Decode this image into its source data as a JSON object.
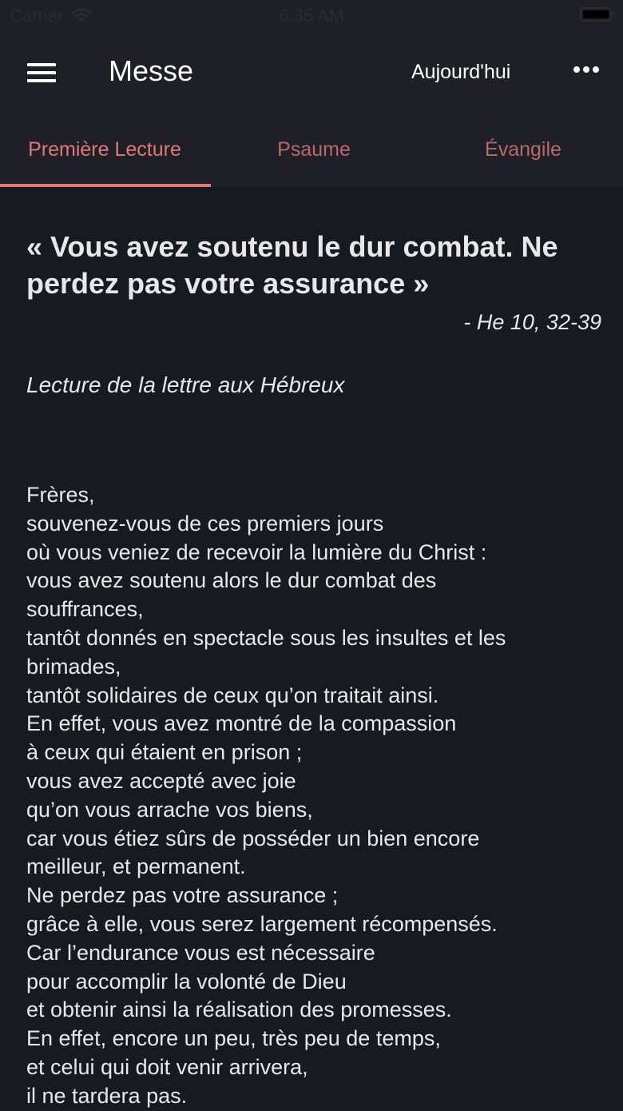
{
  "status": {
    "carrier": "Carrier",
    "time": "6:35 AM"
  },
  "navbar": {
    "title": "Messe",
    "today_label": "Aujourd'hui"
  },
  "tabs": [
    {
      "label": "Première Lecture",
      "active": true
    },
    {
      "label": "Psaume",
      "active": false
    },
    {
      "label": "Évangile",
      "active": false
    }
  ],
  "reading": {
    "title": "« Vous avez soutenu le dur combat. Ne perdez pas votre assurance »",
    "reference": "- He 10, 32-39",
    "intro": "Lecture de la lettre aux Hébreux",
    "lines": [
      "Frères,",
      "souvenez-vous de ces premiers jours",
      "où vous veniez de recevoir la lumière du Christ :",
      "vous avez soutenu alors le dur combat des",
      "souffrances,",
      "tantôt donnés en spectacle sous les insultes et les",
      "brimades,",
      "tantôt solidaires de ceux qu’on traitait ainsi.",
      "En effet, vous avez montré de la compassion",
      "à ceux qui étaient en prison ;",
      "vous avez accepté avec joie",
      "qu’on vous arrache vos biens,",
      "car vous étiez sûrs de posséder un bien encore",
      "meilleur, et permanent.",
      "Ne perdez pas votre assurance ;",
      "grâce à elle, vous serez largement récompensés.",
      "Car l’endurance vous est nécessaire",
      "pour accomplir la volonté de Dieu",
      "et obtenir ainsi la réalisation des promesses.",
      "En effet, encore un peu, très peu de temps,",
      "et celui qui doit venir arrivera,",
      "il ne tardera pas."
    ]
  },
  "colors": {
    "accent": "#e07878",
    "background": "#181a22",
    "header": "#1f2027"
  }
}
